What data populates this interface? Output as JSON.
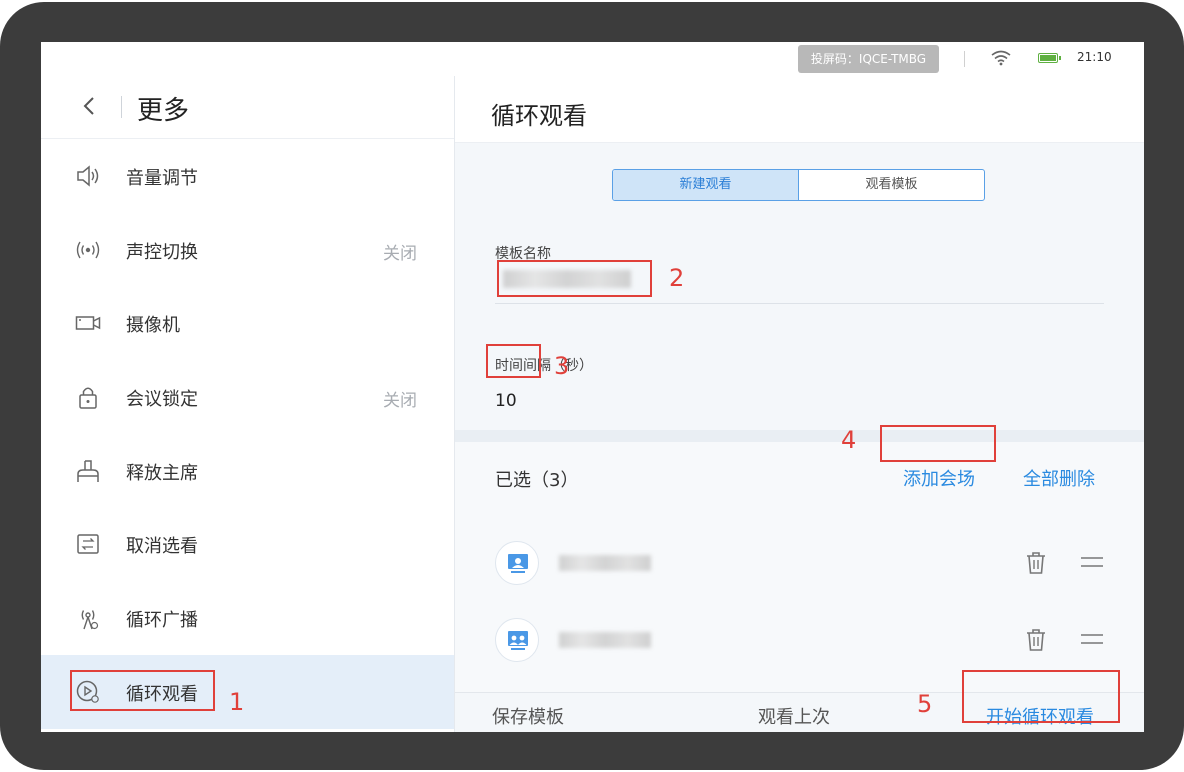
{
  "status_bar": {
    "cast_code": "投屏码：IQCE-TMBG",
    "time": "21:10",
    "icons": [
      "wifi-icon",
      "battery-icon"
    ]
  },
  "left_panel": {
    "title": "更多",
    "items": [
      {
        "icon": "volume-icon",
        "label": "音量调节",
        "value": ""
      },
      {
        "icon": "voice-control-icon",
        "label": "声控切换",
        "value": "关闭"
      },
      {
        "icon": "camera-icon",
        "label": "摄像机",
        "value": ""
      },
      {
        "icon": "lock-icon",
        "label": "会议锁定",
        "value": "关闭"
      },
      {
        "icon": "release-chair-icon",
        "label": "释放主席",
        "value": ""
      },
      {
        "icon": "cancel-view-icon",
        "label": "取消选看",
        "value": ""
      },
      {
        "icon": "broadcast-icon",
        "label": "循环广播",
        "value": ""
      },
      {
        "icon": "loop-view-icon",
        "label": "循环观看",
        "value": ""
      }
    ],
    "active_index": 7
  },
  "right_panel": {
    "title": "循环观看",
    "tabs": [
      "新建观看",
      "观看模板"
    ],
    "active_tab": 0,
    "template_name_label": "模板名称",
    "interval_label": "时间间隔（秒）",
    "interval_value": "10",
    "selected_label": "已选（3）",
    "add_button": "添加会场",
    "delete_all_button": "全部删除",
    "footer": {
      "save_template": "保存模板",
      "view_last": "观看上次",
      "start_loop": "开始循环观看"
    }
  },
  "annotations": [
    "1",
    "2",
    "3",
    "4",
    "5"
  ],
  "colors": {
    "accent": "#2a8ae0",
    "annotation": "#e0403a",
    "active_bg": "#e4eef9"
  }
}
